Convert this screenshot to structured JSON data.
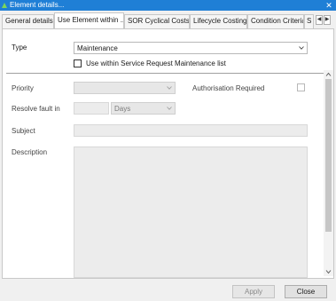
{
  "window": {
    "title": "Element details...",
    "accent": "#1f7fd6"
  },
  "tabs": [
    {
      "label": "General details",
      "active": false
    },
    {
      "label": "Use Element within ...",
      "active": true
    },
    {
      "label": "SOR Cyclical Costs",
      "active": false
    },
    {
      "label": "Lifecycle Costing",
      "active": false
    },
    {
      "label": "Condition Criteria",
      "active": false
    },
    {
      "label": "S",
      "active": false
    }
  ],
  "form": {
    "type_label": "Type",
    "type_value": "Maintenance",
    "service_request_label": "Use within Service Request Maintenance list",
    "priority_label": "Priority",
    "priority_value": "",
    "authorisation_label": "Authorisation Required",
    "resolve_label": "Resolve fault in",
    "resolve_amount": "",
    "resolve_unit": "Days",
    "subject_label": "Subject",
    "subject_value": "",
    "description_label": "Description",
    "description_value": ""
  },
  "buttons": {
    "apply": "Apply",
    "close": "Close"
  },
  "icons": {
    "app": "element-app-icon",
    "close": "close-icon",
    "tab_prev": "tab-scroll-left-icon",
    "tab_next": "tab-scroll-right-icon",
    "dropdown": "chevron-down-icon",
    "scroll_up": "scroll-up-icon",
    "scroll_down": "scroll-down-icon"
  }
}
